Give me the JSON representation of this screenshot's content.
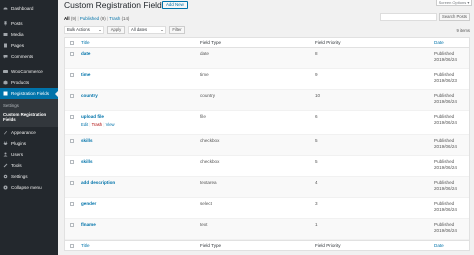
{
  "sidebar": {
    "items": [
      {
        "label": "Dashboard",
        "icon": "dashboard-icon"
      },
      {
        "label": "Posts",
        "icon": "pin-icon"
      },
      {
        "label": "Media",
        "icon": "media-icon"
      },
      {
        "label": "Pages",
        "icon": "page-icon"
      },
      {
        "label": "Comments",
        "icon": "comment-icon"
      },
      {
        "label": "WooCommerce",
        "icon": "woocommerce-icon"
      },
      {
        "label": "Products",
        "icon": "products-icon"
      },
      {
        "label": "Registration Fields",
        "icon": "registration-fields-icon"
      },
      {
        "label": "Appearance",
        "icon": "appearance-icon"
      },
      {
        "label": "Plugins",
        "icon": "plugins-icon"
      },
      {
        "label": "Users",
        "icon": "users-icon"
      },
      {
        "label": "Tools",
        "icon": "tools-icon"
      },
      {
        "label": "Settings",
        "icon": "settings-icon"
      },
      {
        "label": "Collapse menu",
        "icon": "collapse-icon"
      }
    ],
    "submenu": {
      "settings": "Settings",
      "current": "Custom Registration Fields"
    }
  },
  "header": {
    "title": "Custom Registration Fields",
    "add_new": "Add New",
    "screen_options": "Screen Options ▾"
  },
  "views": {
    "all": "All",
    "all_count": "(9)",
    "published": "Published",
    "published_count": "(9)",
    "trash": "Trash",
    "trash_count": "(14)"
  },
  "search": {
    "placeholder": "",
    "button": "Search Posts"
  },
  "toolbar": {
    "bulk_actions": "Bulk Actions",
    "apply": "Apply",
    "dates": "All dates",
    "filter": "Filter",
    "items_count": "9 items"
  },
  "table": {
    "columns": {
      "title": "Title",
      "field_type": "Field Type",
      "field_priority": "Field Priority",
      "date": "Date"
    },
    "rows": [
      {
        "title": "date",
        "type": "date",
        "priority": "8",
        "status": "Published",
        "date": "2019/06/24"
      },
      {
        "title": "time",
        "type": "time",
        "priority": "9",
        "status": "Published",
        "date": "2019/06/23"
      },
      {
        "title": "country",
        "type": "country",
        "priority": "10",
        "status": "Published",
        "date": "2019/06/24"
      },
      {
        "title": "upload file",
        "type": "file",
        "priority": "6",
        "status": "Published",
        "date": "2019/06/24"
      },
      {
        "title": "skills",
        "type": "checkbox",
        "priority": "5",
        "status": "Published",
        "date": "2019/06/24"
      },
      {
        "title": "skills",
        "type": "checkbox",
        "priority": "5",
        "status": "Published",
        "date": "2019/06/24"
      },
      {
        "title": "add description",
        "type": "textarea",
        "priority": "4",
        "status": "Published",
        "date": "2019/06/24"
      },
      {
        "title": "gender",
        "type": "select",
        "priority": "3",
        "status": "Published",
        "date": "2019/06/24"
      },
      {
        "title": "flname",
        "type": "text",
        "priority": "1",
        "status": "Published",
        "date": "2019/06/24"
      }
    ],
    "row_actions": {
      "edit": "Edit",
      "trash": "Trash",
      "view": "View",
      "separator": "|"
    }
  },
  "colors": {
    "sidebar_bg": "#23282d",
    "accent": "#0073aa",
    "trash": "#a00"
  }
}
